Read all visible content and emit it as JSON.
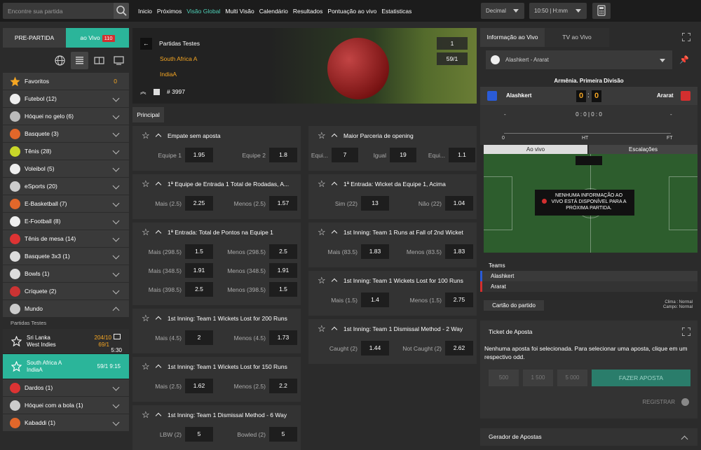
{
  "search": {
    "placeholder": "Encontre sua partida"
  },
  "nav": [
    "Inicio",
    "Próximos",
    "Visão Global",
    "Multi Visão",
    "Calendário",
    "Resultados",
    "Pontuação ao vivo",
    "Estatisticas"
  ],
  "nav_active": "Visão Global",
  "odds_format": "Decimal",
  "time_format": "10:50 | H:mm",
  "sidebar": {
    "tab_pre": "PRE-PARTIDA",
    "tab_live": "ao Vivo",
    "live_count": "110",
    "sports": [
      {
        "label": "Favoritos",
        "count": "0",
        "icon": "star-icon",
        "color": "#f5a623"
      },
      {
        "label": "Futebol (12)",
        "icon": "soccer-ball-icon",
        "color": "#eee"
      },
      {
        "label": "Hóquei no gelo (6)",
        "icon": "hockey-puck-icon",
        "color": "#bbb"
      },
      {
        "label": "Basquete (3)",
        "icon": "basketball-icon",
        "color": "#e2672a"
      },
      {
        "label": "Tênis (28)",
        "icon": "tennis-ball-icon",
        "color": "#c8d629"
      },
      {
        "label": "Voleibol (5)",
        "icon": "volleyball-icon",
        "color": "#eee"
      },
      {
        "label": "eSports (20)",
        "icon": "gamepad-icon",
        "color": "#ccc"
      },
      {
        "label": "E-Basketball (7)",
        "icon": "e-basketball-icon",
        "color": "#e2672a"
      },
      {
        "label": "E-Football (8)",
        "icon": "e-football-icon",
        "color": "#eee"
      },
      {
        "label": "Tênis de mesa (14)",
        "icon": "table-tennis-icon",
        "color": "#d33"
      },
      {
        "label": "Basquete 3x3 (1)",
        "icon": "basketball-3x3-icon",
        "color": "#ddd"
      },
      {
        "label": "Bowls (1)",
        "icon": "bowls-icon",
        "color": "#ddd"
      },
      {
        "label": "Críquete (2)",
        "icon": "cricket-ball-icon",
        "color": "#c33"
      },
      {
        "label": "Mundo",
        "icon": "world-icon",
        "color": "#ccc"
      }
    ],
    "subheader": "Partidas Testes",
    "matches": [
      {
        "team1": "Sri Lanka",
        "team2": "West Indies",
        "score1": "204/10",
        "score2": "69/1",
        "time": "5:30"
      },
      {
        "team1": "South Africa A",
        "team2": "IndiaA",
        "score": "59/1 9:15"
      }
    ],
    "sports_after": [
      {
        "label": "Dardos (1)",
        "icon": "darts-icon",
        "color": "#d33"
      },
      {
        "label": "Hóquei com a bola (1)",
        "icon": "bandy-icon",
        "color": "#ccc"
      },
      {
        "label": "Kabaddi (1)",
        "icon": "kabaddi-icon",
        "color": "#e2672a"
      }
    ]
  },
  "hero": {
    "title": "Partidas Testes",
    "title_val": "1",
    "team1": "South Africa A",
    "team1_val": "59/1",
    "team2": "IndiaA",
    "event_id": "# 3997"
  },
  "tab_main": "Principal",
  "markets_left": [
    {
      "title": "Empate sem aposta",
      "rows": [
        [
          [
            "Equipe 1",
            "1.95"
          ],
          [
            "Equipe 2",
            "1.8"
          ]
        ]
      ]
    },
    {
      "title": "1ª Equipe de Entrada 1 Total de Rodadas, A...",
      "rows": [
        [
          [
            "Mais (2.5)",
            "2.25"
          ],
          [
            "Menos (2.5)",
            "1.57"
          ]
        ]
      ]
    },
    {
      "title": "1ª Entrada: Total de Pontos na Equipe 1",
      "rows": [
        [
          [
            "Mais (298.5)",
            "1.5"
          ],
          [
            "Menos (298.5)",
            "2.5"
          ]
        ],
        [
          [
            "Mais (348.5)",
            "1.91"
          ],
          [
            "Menos (348.5)",
            "1.91"
          ]
        ],
        [
          [
            "Mais (398.5)",
            "2.5"
          ],
          [
            "Menos (398.5)",
            "1.5"
          ]
        ]
      ]
    },
    {
      "title": "1st Inning: Team 1 Wickets Lost for 200 Runs",
      "rows": [
        [
          [
            "Mais (4.5)",
            "2"
          ],
          [
            "Menos (4.5)",
            "1.73"
          ]
        ]
      ]
    },
    {
      "title": "1st Inning: Team 1 Wickets Lost for 150 Runs",
      "rows": [
        [
          [
            "Mais (2.5)",
            "1.62"
          ],
          [
            "Menos (2.5)",
            "2.2"
          ]
        ]
      ]
    },
    {
      "title": "1st Inning: Team 1 Dismissal Method - 6 Way",
      "rows": [
        [
          [
            "LBW (2)",
            "5"
          ],
          [
            "Bowled (2)",
            "5"
          ]
        ]
      ]
    }
  ],
  "markets_right": [
    {
      "title": "Maior Parceria de opening",
      "rows": [
        [
          [
            "Equi...",
            "7"
          ],
          [
            "Igual",
            "19"
          ],
          [
            "Equi...",
            "1.1"
          ]
        ]
      ]
    },
    {
      "title": "1ª Entrada: Wicket da Equipe 1, Acima",
      "rows": [
        [
          [
            "Sim (22)",
            "13"
          ],
          [
            "Não (22)",
            "1.04"
          ]
        ]
      ]
    },
    {
      "title": "1st Inning: Team 1 Runs at Fall of 2nd Wicket",
      "rows": [
        [
          [
            "Mais (83.5)",
            "1.83"
          ],
          [
            "Menos (83.5)",
            "1.83"
          ]
        ]
      ]
    },
    {
      "title": "1st Inning: Team 1 Wickets Lost for 100 Runs",
      "rows": [
        [
          [
            "Mais (1.5)",
            "1.4"
          ],
          [
            "Menos (1.5)",
            "2.75"
          ]
        ]
      ]
    },
    {
      "title": "1st Inning: Team 1 Dismissal Method - 2 Way",
      "rows": [
        [
          [
            "Caught (2)",
            "1.44"
          ],
          [
            "Not Caught (2)",
            "2.62"
          ]
        ]
      ]
    }
  ],
  "live": {
    "tab_info": "Informação ao Vivo",
    "tab_tv": "TV ao Vivo",
    "match_select": "Alashkert - Ararat",
    "league": "Armênia. Primeira Divisão",
    "home": "Alashkert",
    "away": "Ararat",
    "home_score": "0",
    "away_score": "0",
    "dash_left": "-",
    "dash_right": "-",
    "stats_line": "0 : 0 | 0 : 0",
    "timeline_start": "0",
    "timeline_ht": "HT",
    "timeline_ft": "FT",
    "tab_live": "Ao vivo",
    "tab_lineups": "Escalações",
    "no_info": "NENHUMA INFORMAÇÃO AO VIVO ESTÁ DISPONÍVEL PARA A PRÓXIMA PARTIDA.",
    "teams_header": "Teams",
    "team_a": "Alashkert",
    "team_b": "Ararat",
    "match_card": "Cartão do partido",
    "weather": "Clima : Normal",
    "pitch": "Campo: Normal"
  },
  "ticket": {
    "title": "Ticket de Aposta",
    "empty": "Nenhuma aposta foi selecionada. Para selecionar uma aposta, clique em um respectivo odd.",
    "stakes": [
      "500",
      "1 500",
      "5 000"
    ],
    "submit": "FAZER APOSTA",
    "register": "REGISTRAR"
  },
  "gerador": "Gerador de Apostas",
  "colors": {
    "accent": "#2bb59a",
    "gold": "#f5a623",
    "live_badge": "#d32f2f"
  }
}
